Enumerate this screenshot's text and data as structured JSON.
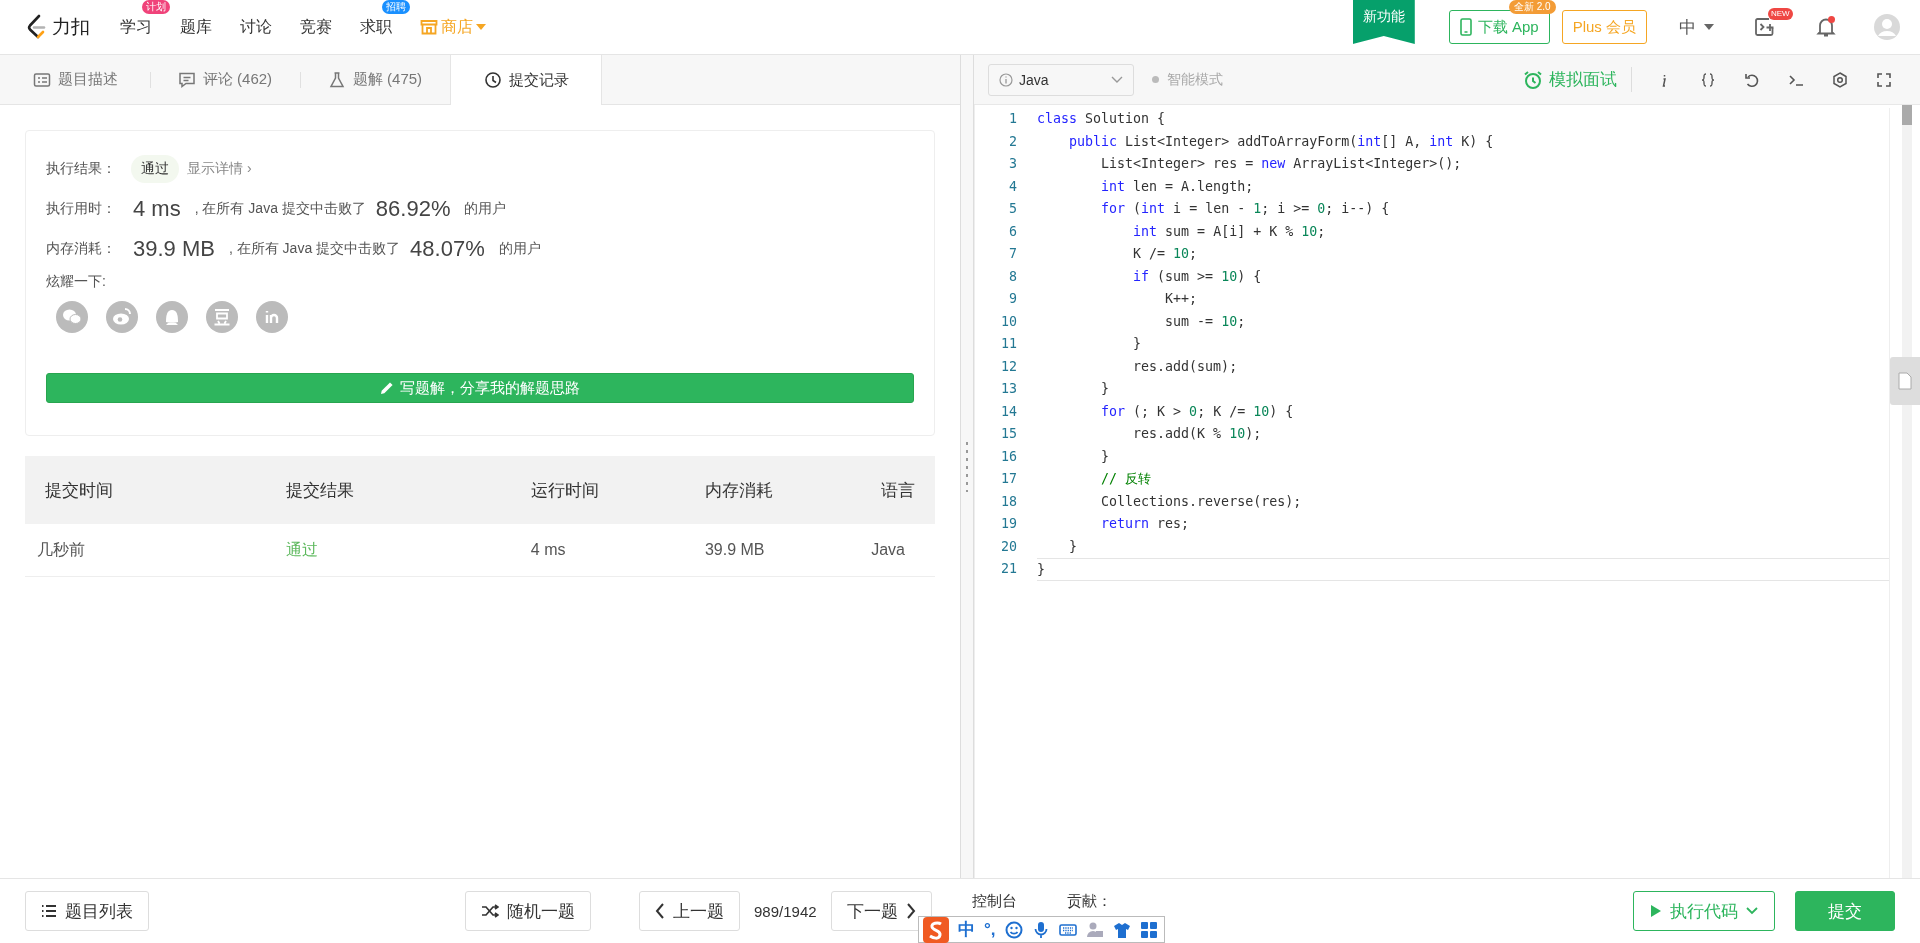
{
  "nav": {
    "brand": "力扣",
    "items": [
      {
        "label": "学习",
        "kind": "link",
        "badge": {
          "text": "计划",
          "color": "#f0437a"
        }
      },
      {
        "label": "题库",
        "kind": "link"
      },
      {
        "label": "讨论",
        "kind": "link"
      },
      {
        "label": "竞赛",
        "kind": "link"
      },
      {
        "label": "求职",
        "kind": "link",
        "badge": {
          "text": "招聘",
          "color": "#1a90ff"
        }
      },
      {
        "label": "商店",
        "kind": "shop"
      }
    ],
    "new_feature": "新功能",
    "download": {
      "label": "下载 App",
      "badge": "全新 2.0"
    },
    "plus": "Plus 会员",
    "language": "中",
    "new_badge": "NEW",
    "unread": true
  },
  "tabs": [
    {
      "label": "题目描述",
      "kind": "description",
      "selected": false
    },
    {
      "label": "评论 (462)",
      "kind": "comments",
      "selected": false
    },
    {
      "label": "题解 (475)",
      "kind": "solutions",
      "selected": false
    },
    {
      "label": "提交记录",
      "kind": "submissions",
      "selected": true
    }
  ],
  "result": {
    "label": "执行结果：",
    "status": "通过",
    "details": "显示详情 ›",
    "stats": [
      {
        "label": "执行用时：",
        "value": "4 ms",
        "text": ", 在所有 Java 提交中击败了",
        "percent": "86.92%",
        "suffix": "的用户"
      },
      {
        "label": "内存消耗：",
        "value": "39.9 MB",
        "text": ", 在所有 Java 提交中击败了",
        "percent": "48.07%",
        "suffix": "的用户"
      }
    ],
    "share_label": "炫耀一下:",
    "write_button": "写题解，分享我的解题思路"
  },
  "table": {
    "columns": [
      "提交时间",
      "提交结果",
      "运行时间",
      "内存消耗",
      "语言"
    ],
    "rows": [
      {
        "cells": [
          "几秒前",
          "通过",
          "4 ms",
          "39.9 MB",
          "Java"
        ],
        "passed": true
      }
    ]
  },
  "editor": {
    "language": "Java",
    "mode": "智能模式",
    "interview": "模拟面试",
    "lines": [
      {
        "number": "1",
        "current": false,
        "tokens": [
          {
            "kind": "kw",
            "text": "class"
          },
          {
            "kind": "plain",
            "text": " Solution {"
          }
        ]
      },
      {
        "number": "2",
        "current": false,
        "tokens": [
          {
            "kind": "kw",
            "text": "    public"
          },
          {
            "kind": "plain",
            "text": " List<Integer> addToArrayForm("
          },
          {
            "kind": "kw",
            "text": "int"
          },
          {
            "kind": "plain",
            "text": "[] A, "
          },
          {
            "kind": "kw",
            "text": "int"
          },
          {
            "kind": "plain",
            "text": " K) {"
          }
        ]
      },
      {
        "number": "3",
        "current": false,
        "tokens": [
          {
            "kind": "plain",
            "text": "        List<Integer> res = "
          },
          {
            "kind": "kw",
            "text": "new"
          },
          {
            "kind": "plain",
            "text": " ArrayList<Integer>();"
          }
        ]
      },
      {
        "number": "4",
        "current": false,
        "tokens": [
          {
            "kind": "kw",
            "text": "        int"
          },
          {
            "kind": "plain",
            "text": " len = A.length;"
          }
        ]
      },
      {
        "number": "5",
        "current": false,
        "tokens": [
          {
            "kind": "kw",
            "text": "        for"
          },
          {
            "kind": "plain",
            "text": " ("
          },
          {
            "kind": "kw",
            "text": "int"
          },
          {
            "kind": "plain",
            "text": " i = len - "
          },
          {
            "kind": "num",
            "text": "1"
          },
          {
            "kind": "plain",
            "text": "; i >= "
          },
          {
            "kind": "num",
            "text": "0"
          },
          {
            "kind": "plain",
            "text": "; i--) {"
          }
        ]
      },
      {
        "number": "6",
        "current": false,
        "tokens": [
          {
            "kind": "kw",
            "text": "            int"
          },
          {
            "kind": "plain",
            "text": " sum = A[i] + K % "
          },
          {
            "kind": "num",
            "text": "10"
          },
          {
            "kind": "plain",
            "text": ";"
          }
        ]
      },
      {
        "number": "7",
        "current": false,
        "tokens": [
          {
            "kind": "plain",
            "text": "            K /= "
          },
          {
            "kind": "num",
            "text": "10"
          },
          {
            "kind": "plain",
            "text": ";"
          }
        ]
      },
      {
        "number": "8",
        "current": false,
        "tokens": [
          {
            "kind": "kw",
            "text": "            if"
          },
          {
            "kind": "plain",
            "text": " (sum >= "
          },
          {
            "kind": "num",
            "text": "10"
          },
          {
            "kind": "plain",
            "text": ") {"
          }
        ]
      },
      {
        "number": "9",
        "current": false,
        "tokens": [
          {
            "kind": "plain",
            "text": "                K++;"
          }
        ]
      },
      {
        "number": "10",
        "current": false,
        "tokens": [
          {
            "kind": "plain",
            "text": "                sum -= "
          },
          {
            "kind": "num",
            "text": "10"
          },
          {
            "kind": "plain",
            "text": ";"
          }
        ]
      },
      {
        "number": "11",
        "current": false,
        "tokens": [
          {
            "kind": "plain",
            "text": "            }"
          }
        ]
      },
      {
        "number": "12",
        "current": false,
        "tokens": [
          {
            "kind": "plain",
            "text": "            res.add(sum);"
          }
        ]
      },
      {
        "number": "13",
        "current": false,
        "tokens": [
          {
            "kind": "plain",
            "text": "        }"
          }
        ]
      },
      {
        "number": "14",
        "current": false,
        "tokens": [
          {
            "kind": "kw",
            "text": "        for"
          },
          {
            "kind": "plain",
            "text": " (; K > "
          },
          {
            "kind": "num",
            "text": "0"
          },
          {
            "kind": "plain",
            "text": "; K /= "
          },
          {
            "kind": "num",
            "text": "10"
          },
          {
            "kind": "plain",
            "text": ") {"
          }
        ]
      },
      {
        "number": "15",
        "current": false,
        "tokens": [
          {
            "kind": "plain",
            "text": "            res.add(K % "
          },
          {
            "kind": "num",
            "text": "10"
          },
          {
            "kind": "plain",
            "text": ");"
          }
        ]
      },
      {
        "number": "16",
        "current": false,
        "tokens": [
          {
            "kind": "plain",
            "text": "        }"
          }
        ]
      },
      {
        "number": "17",
        "current": false,
        "tokens": [
          {
            "kind": "comment",
            "text": "        // 反转"
          }
        ]
      },
      {
        "number": "18",
        "current": false,
        "tokens": [
          {
            "kind": "plain",
            "text": "        Collections.reverse(res);"
          }
        ]
      },
      {
        "number": "19",
        "current": false,
        "tokens": [
          {
            "kind": "kw",
            "text": "        return"
          },
          {
            "kind": "plain",
            "text": " res;"
          }
        ]
      },
      {
        "number": "20",
        "current": false,
        "tokens": [
          {
            "kind": "plain",
            "text": "    }"
          }
        ]
      },
      {
        "number": "21",
        "current": true,
        "tokens": [
          {
            "kind": "plain",
            "text": "}"
          }
        ]
      }
    ]
  },
  "bottom": {
    "problem_list": "题目列表",
    "random": "随机一题",
    "prev": "上一题",
    "position": "989/1942",
    "next": "下一题",
    "console": "控制台",
    "contribute": "贡献：",
    "run": "执行代码",
    "submit": "提交"
  },
  "ime": {
    "mode": "中",
    "punct": "°,"
  }
}
